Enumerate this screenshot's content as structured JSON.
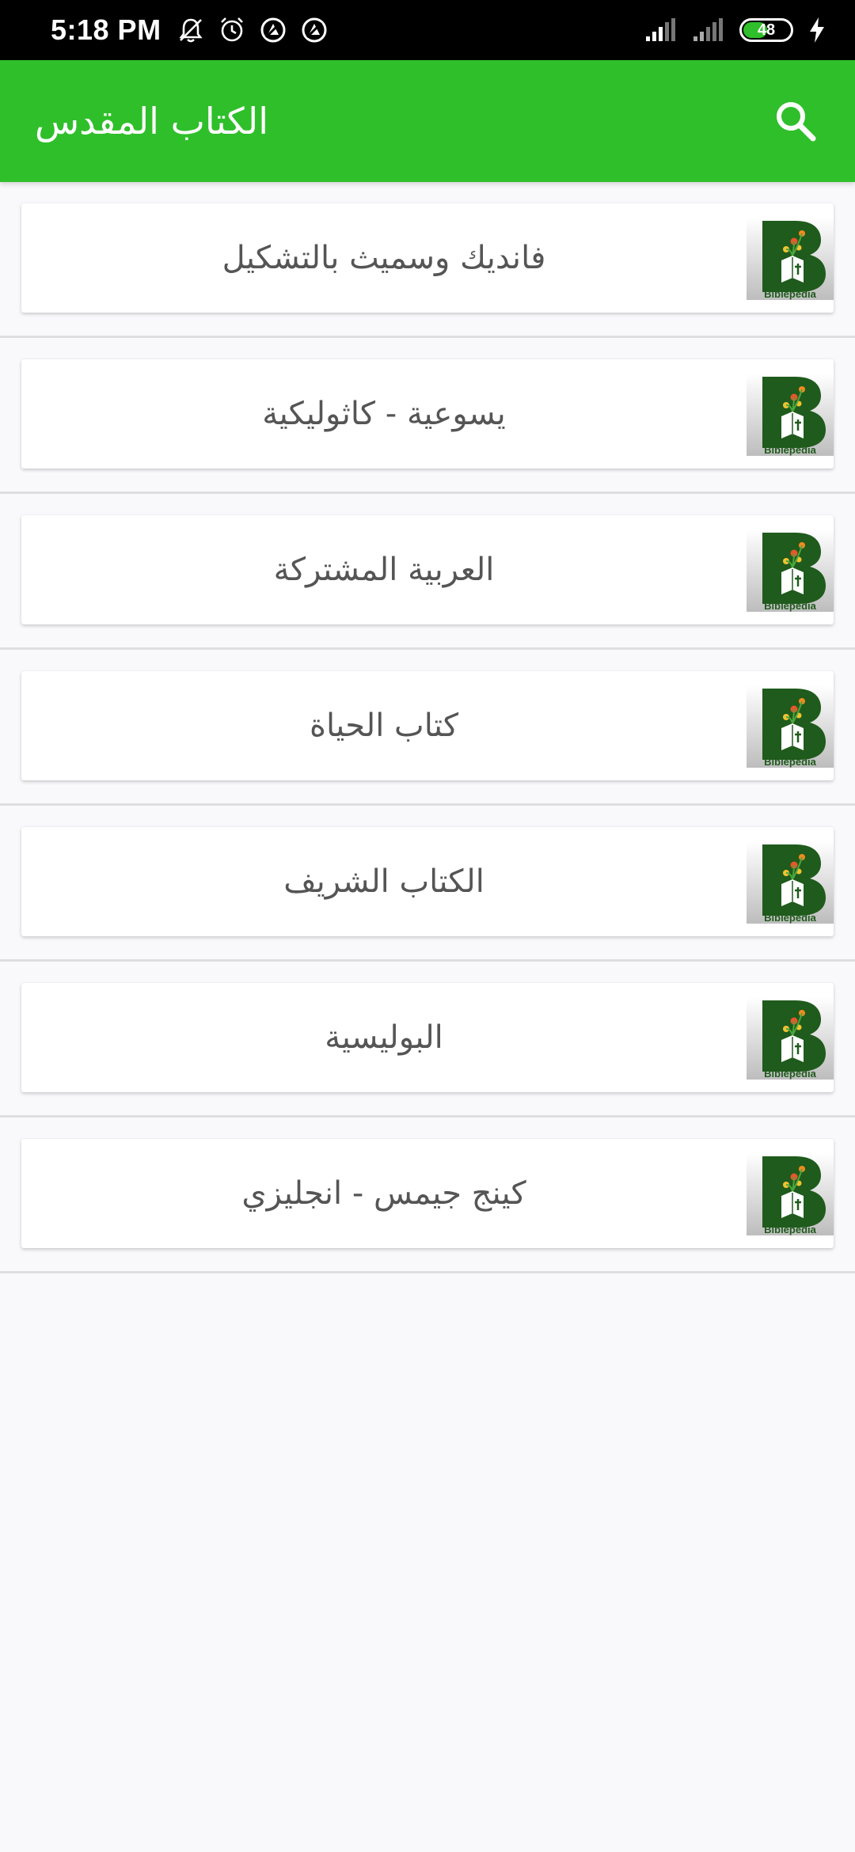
{
  "status_bar": {
    "time": "5:18 PM",
    "battery_level": "48",
    "icons": [
      "notifications-muted-icon",
      "alarm-icon",
      "vpn-icon",
      "vpn-icon",
      "signal-icon",
      "signal-icon",
      "battery-icon",
      "charging-icon"
    ]
  },
  "app_bar": {
    "title": "الكتاب المقدس",
    "search_icon": "search-icon"
  },
  "logo_label": "Biblepedia",
  "bible_versions": [
    {
      "label": "فانديك وسميث بالتشكيل"
    },
    {
      "label": "يسوعية - كاثوليكية"
    },
    {
      "label": "العربية المشتركة"
    },
    {
      "label": "كتاب الحياة"
    },
    {
      "label": "الكتاب الشريف"
    },
    {
      "label": "البوليسية"
    },
    {
      "label": "كينج جيمس - انجليزي"
    }
  ],
  "colors": {
    "primary": "#2fbf2a",
    "logo_green": "#1f5b1c",
    "text": "#555555",
    "background": "#f9f8fb"
  }
}
